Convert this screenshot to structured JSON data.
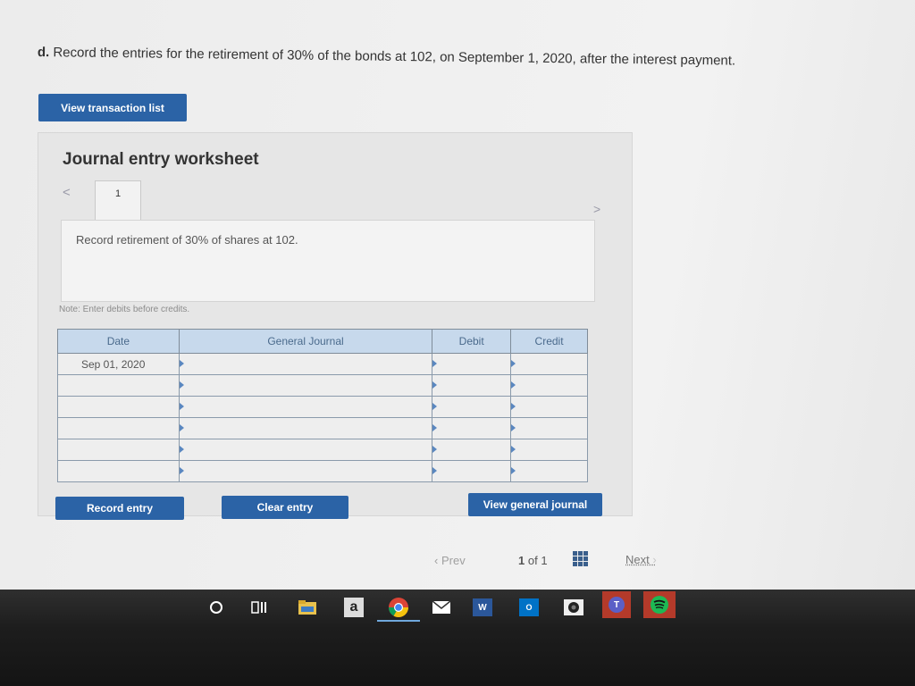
{
  "question": {
    "letter": "d.",
    "text": "Record the entries for the retirement of 30% of the bonds at 102, on September 1, 2020, after the interest payment."
  },
  "buttons": {
    "view_transaction_list": "View transaction list",
    "record_entry": "Record entry",
    "clear_entry": "Clear entry",
    "view_general_journal": "View general journal"
  },
  "worksheet": {
    "title": "Journal entry worksheet",
    "tab_label": "1",
    "prev_arrow": "<",
    "next_arrow": ">",
    "description": "Record retirement of 30% of shares at 102.",
    "note": "Note: Enter debits before credits."
  },
  "table": {
    "headers": [
      "Date",
      "General Journal",
      "Debit",
      "Credit"
    ],
    "rows": [
      [
        "Sep 01, 2020",
        "",
        "",
        ""
      ],
      [
        "",
        "",
        "",
        ""
      ],
      [
        "",
        "",
        "",
        ""
      ],
      [
        "",
        "",
        "",
        ""
      ],
      [
        "",
        "",
        "",
        ""
      ],
      [
        "",
        "",
        "",
        ""
      ]
    ]
  },
  "pager": {
    "prev": "Prev",
    "current": "1",
    "of": "of",
    "total": "1",
    "next": "Next"
  },
  "taskbar": {
    "icons": [
      "cortana-icon",
      "task-view-icon",
      "file-explorer-icon",
      "amazon-icon",
      "chrome-icon",
      "mail-icon",
      "word-icon",
      "outlook-icon",
      "camera-icon",
      "teams-icon",
      "spotify-icon"
    ],
    "amazon_letter": "a",
    "word_letter": "W",
    "outlook_letter": "O",
    "teams_letter": "T"
  },
  "colors": {
    "button_blue": "#2b63a6",
    "table_header": "#c7d9ec",
    "taskbar": "#1d1d1d"
  }
}
